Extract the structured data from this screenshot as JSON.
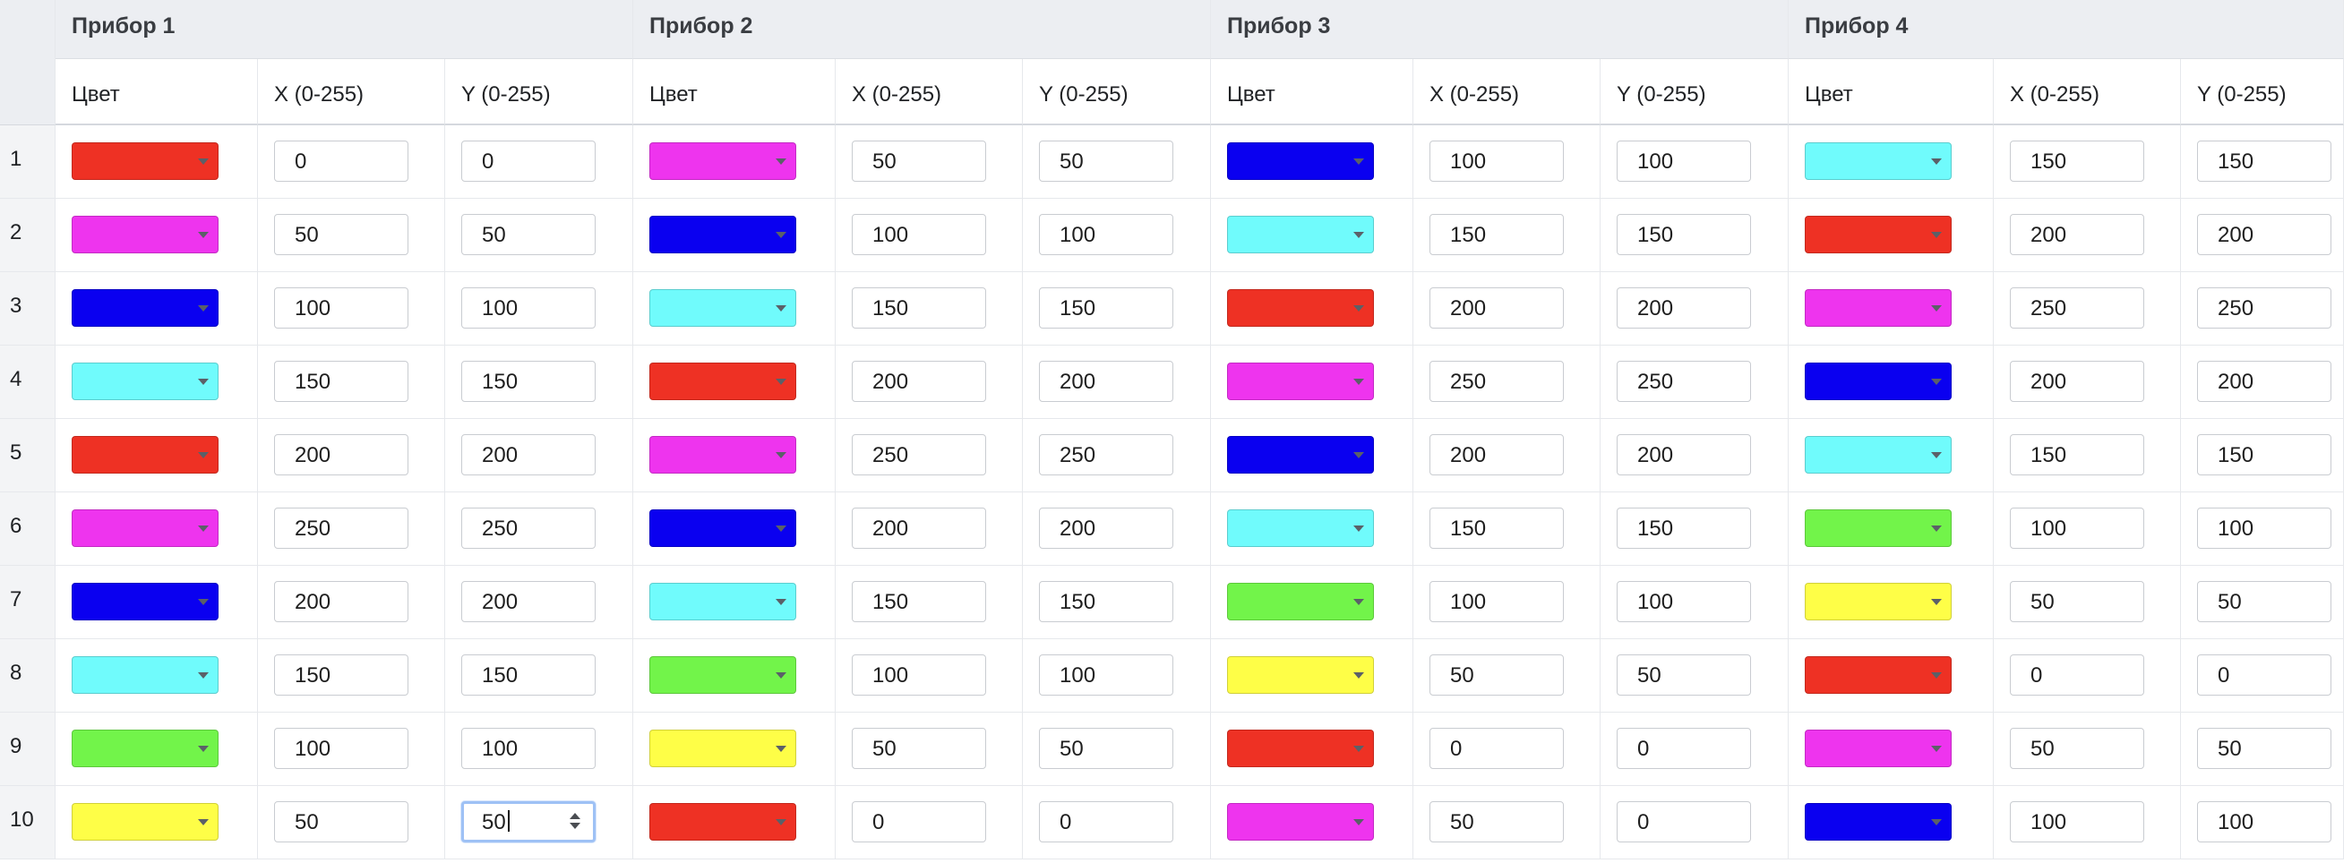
{
  "colors": {
    "red": "#EE3124",
    "magenta": "#EE34EE",
    "blue": "#0A00F0",
    "cyan": "#70FBFC",
    "green": "#72F44A",
    "yellow": "#FEFE47"
  },
  "devices": [
    {
      "title": "Прибор 1",
      "columns": [
        "Цвет",
        "X (0-255)",
        "Y (0-255)"
      ],
      "rows": [
        {
          "color": "red",
          "x": "0",
          "y": "0"
        },
        {
          "color": "magenta",
          "x": "50",
          "y": "50"
        },
        {
          "color": "blue",
          "x": "100",
          "y": "100"
        },
        {
          "color": "cyan",
          "x": "150",
          "y": "150"
        },
        {
          "color": "red",
          "x": "200",
          "y": "200"
        },
        {
          "color": "magenta",
          "x": "250",
          "y": "250"
        },
        {
          "color": "blue",
          "x": "200",
          "y": "200"
        },
        {
          "color": "cyan",
          "x": "150",
          "y": "150"
        },
        {
          "color": "green",
          "x": "100",
          "y": "100"
        },
        {
          "color": "yellow",
          "x": "50",
          "y": "50"
        }
      ]
    },
    {
      "title": "Прибор 2",
      "columns": [
        "Цвет",
        "X (0-255)",
        "Y (0-255)"
      ],
      "rows": [
        {
          "color": "magenta",
          "x": "50",
          "y": "50"
        },
        {
          "color": "blue",
          "x": "100",
          "y": "100"
        },
        {
          "color": "cyan",
          "x": "150",
          "y": "150"
        },
        {
          "color": "red",
          "x": "200",
          "y": "200"
        },
        {
          "color": "magenta",
          "x": "250",
          "y": "250"
        },
        {
          "color": "blue",
          "x": "200",
          "y": "200"
        },
        {
          "color": "cyan",
          "x": "150",
          "y": "150"
        },
        {
          "color": "green",
          "x": "100",
          "y": "100"
        },
        {
          "color": "yellow",
          "x": "50",
          "y": "50"
        },
        {
          "color": "red",
          "x": "0",
          "y": "0"
        }
      ]
    },
    {
      "title": "Прибор 3",
      "columns": [
        "Цвет",
        "X (0-255)",
        "Y (0-255)"
      ],
      "rows": [
        {
          "color": "blue",
          "x": "100",
          "y": "100"
        },
        {
          "color": "cyan",
          "x": "150",
          "y": "150"
        },
        {
          "color": "red",
          "x": "200",
          "y": "200"
        },
        {
          "color": "magenta",
          "x": "250",
          "y": "250"
        },
        {
          "color": "blue",
          "x": "200",
          "y": "200"
        },
        {
          "color": "cyan",
          "x": "150",
          "y": "150"
        },
        {
          "color": "green",
          "x": "100",
          "y": "100"
        },
        {
          "color": "yellow",
          "x": "50",
          "y": "50"
        },
        {
          "color": "red",
          "x": "0",
          "y": "0"
        },
        {
          "color": "magenta",
          "x": "50",
          "y": "0"
        }
      ]
    },
    {
      "title": "Прибор 4",
      "columns": [
        "Цвет",
        "X (0-255)",
        "Y (0-255)"
      ],
      "rows": [
        {
          "color": "cyan",
          "x": "150",
          "y": "150"
        },
        {
          "color": "red",
          "x": "200",
          "y": "200"
        },
        {
          "color": "magenta",
          "x": "250",
          "y": "250"
        },
        {
          "color": "blue",
          "x": "200",
          "y": "200"
        },
        {
          "color": "cyan",
          "x": "150",
          "y": "150"
        },
        {
          "color": "green",
          "x": "100",
          "y": "100"
        },
        {
          "color": "yellow",
          "x": "50",
          "y": "50"
        },
        {
          "color": "red",
          "x": "0",
          "y": "0"
        },
        {
          "color": "magenta",
          "x": "50",
          "y": "50"
        },
        {
          "color": "blue",
          "x": "100",
          "y": "100"
        }
      ]
    }
  ],
  "row_numbers": [
    "1",
    "2",
    "3",
    "4",
    "5",
    "6",
    "7",
    "8",
    "9",
    "10"
  ],
  "focused_field": {
    "device": 1,
    "row": 10,
    "axis": "Y"
  }
}
